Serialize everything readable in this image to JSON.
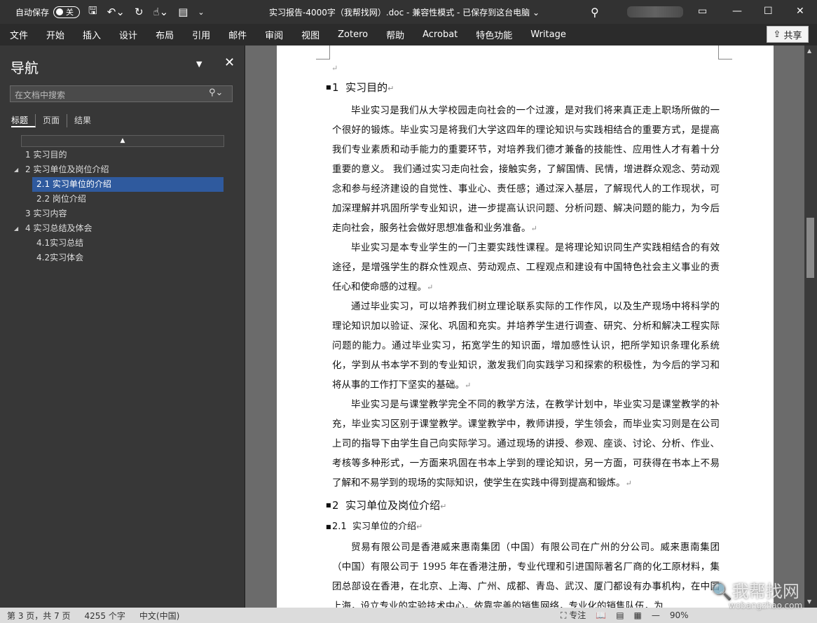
{
  "titlebar": {
    "autosave_label": "自动保存",
    "autosave_state": "关",
    "doc_title": "实习报告-4000字（我帮找网）.doc  -  兼容性模式  -  已保存到这台电脑 ⌄",
    "icons": [
      "save-icon",
      "undo-icon",
      "redo-icon",
      "touch-mode-icon",
      "print-preview-icon",
      "customize-icon"
    ]
  },
  "ribbon": {
    "tabs": [
      "文件",
      "开始",
      "插入",
      "设计",
      "布局",
      "引用",
      "邮件",
      "审阅",
      "视图",
      "Zotero",
      "帮助",
      "Acrobat",
      "特色功能",
      "Writage"
    ],
    "share_label": "共享"
  },
  "nav": {
    "title": "导航",
    "search_placeholder": "在文档中搜索",
    "tabs": [
      "标题",
      "页面",
      "结果"
    ],
    "outline": [
      {
        "label": "1 实习目的",
        "level": 1,
        "expand": false,
        "selected": false
      },
      {
        "label": "2 实习单位及岗位介绍",
        "level": 1,
        "expand": true,
        "selected": false
      },
      {
        "label": "2.1 实习单位的介绍",
        "level": 2,
        "expand": false,
        "selected": true
      },
      {
        "label": "2.2 岗位介绍",
        "level": 2,
        "expand": false,
        "selected": false
      },
      {
        "label": "3 实习内容",
        "level": 1,
        "expand": false,
        "selected": false
      },
      {
        "label": "4 实习总结及体会",
        "level": 1,
        "expand": true,
        "selected": false
      },
      {
        "label": "4.1实习总结",
        "level": 2,
        "expand": false,
        "selected": false
      },
      {
        "label": "4.2实习体会",
        "level": 2,
        "expand": false,
        "selected": false
      }
    ]
  },
  "document": {
    "h1_num": "1",
    "h1_text": "实习目的",
    "p1": "毕业实习是我们从大学校园走向社会的一个过渡，是对我们将来真正走上职场所做的一个很好的锻炼。毕业实习是将我们大学这四年的理论知识与实践相结合的重要方式，是提高我们专业素质和动手能力的重要环节，对培养我们德才兼备的技能性、应用性人才有着十分重要的意义。 我们通过实习走向社会，接触实务，了解国情、民情，增进群众观念、劳动观念和参与经济建设的自觉性、事业心、责任感；通过深入基层，了解现代人的工作现状，可加深理解并巩固所学专业知识，进一步提高认识问题、分析问题、解决问题的能力，为今后走向社会，服务社会做好思想准备和业务准备。",
    "p2": "毕业实习是本专业学生的一门主要实践性课程。是将理论知识同生产实践相结合的有效途径，是增强学生的群众性观点、劳动观点、工程观点和建设有中国特色社会主义事业的责任心和使命感的过程。",
    "p3": "通过毕业实习，可以培养我们树立理论联系实际的工作作风，以及生产现场中将科学的理论知识加以验证、深化、巩固和充实。并培养学生进行调查、研究、分析和解决工程实际问题的能力。通过毕业实习，拓宽学生的知识面，增加感性认识，把所学知识条理化系统化，学到从书本学不到的专业知识，激发我们向实践学习和探索的积极性，为今后的学习和将从事的工作打下坚实的基础。",
    "p4": "毕业实习是与课堂教学完全不同的教学方法，在教学计划中，毕业实习是课堂教学的补充，毕业实习区别于课堂教学。课堂教学中，教师讲授，学生领会，而毕业实习则是在公司上司的指导下由学生自己向实际学习。通过现场的讲授、参观、座谈、讨论、分析、作业、考核等多种形式，一方面来巩固在书本上学到的理论知识，另一方面，可获得在书本上不易了解和不易学到的现场的实际知识，使学生在实践中得到提高和锻炼。",
    "h2_num": "2",
    "h2_text": "实习单位及岗位介绍",
    "h3_num": "2.1",
    "h3_text": "实习单位的介绍",
    "p5": "贸易有限公司是香港威来惠南集团（中国）有限公司在广州的分公司。威来惠南集团（中国）有限公司于 1995 年在香港注册，专业代理和引进国际著名厂商的化工原材料，集团总部设在香港，在北京、上海、广州、成都、青岛、武汉、厦门都设有办事机构，在中国上海，设立专业的实验技术中心，依靠完善的销售网络，专业化的销售队伍，为"
  },
  "status": {
    "page": "第 3 页，共 7 页",
    "words": "4255 个字",
    "lang": "中文(中国)",
    "focus": "专注",
    "zoom": "90%"
  },
  "watermark": {
    "main": "我帮找网",
    "sub": "wobangzhao.com"
  }
}
